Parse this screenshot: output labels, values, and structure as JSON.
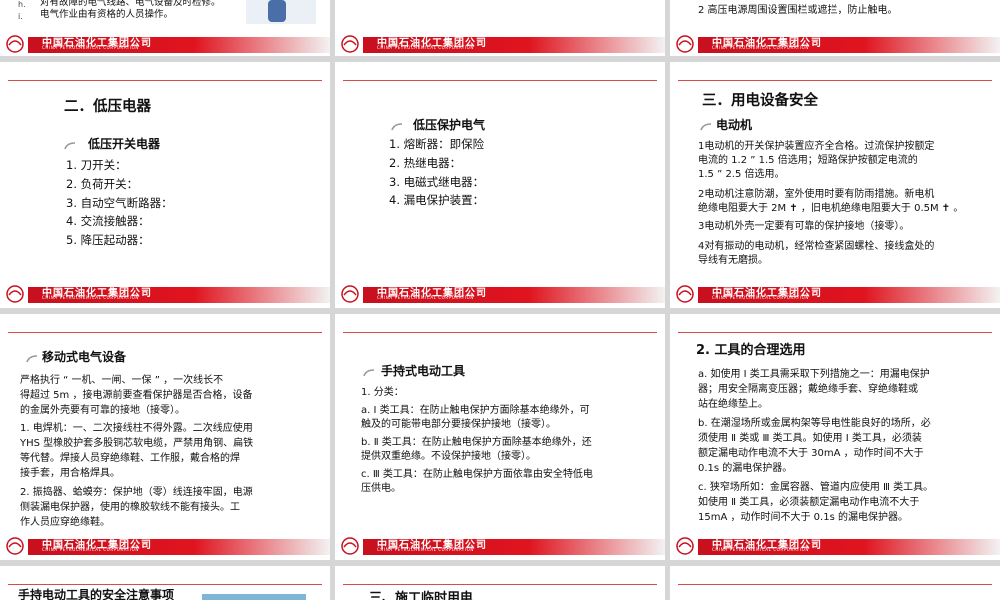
{
  "footer": {
    "company_cn": "中国石油化工集团公司",
    "company_en": "CHINA PETROCHEMICAL CORPORATION",
    "logo_text": "SINOPEC"
  },
  "s1": {
    "items": [
      {
        "marker": "h.",
        "text": "对有故障的电气线路、电气设备及时检修。"
      },
      {
        "marker": "i.",
        "text": "电气作业由有资格的人员操作。"
      }
    ]
  },
  "s3": {
    "item": "2   高压电源周围设置围栏或遮拦，防止触电。"
  },
  "s4": {
    "title": "二．低压电器",
    "subtitle": "低压开关电器",
    "items": [
      "1.   刀开关：",
      "2.   负荷开关：",
      "3.   自动空气断路器：",
      "4.   交流接触器：",
      "5.   降压起动器："
    ]
  },
  "s5": {
    "subtitle": "低压保护电气",
    "items": [
      "1.   熔断器：即保险",
      "2.   热继电器：",
      "3.   电磁式继电器：",
      "4.   漏电保护装置："
    ]
  },
  "s6": {
    "title": "三．用电设备安全",
    "subtitle": "电动机",
    "lines": [
      "1电动机的开关保护装置应齐全合格。过流保护按额定",
      "   电流的 1.2 ” 1.5 倍选用；短路保护按额定电流的",
      "   1.5 ” 2.5 倍选用。",
      "2电动机注意防潮，室外使用时要有防雨措施。新电机",
      "   绝缘电阻要大于 2M ✝ ，旧电机绝缘电阻要大于 0.5M ✝ 。",
      "3电动机外壳一定要有可靠的保护接地（接零）。",
      "4对有振动的电动机，经常检查紧固螺栓、接线盒处的",
      "   导线有无磨损。"
    ]
  },
  "s7": {
    "subtitle": "移动式电气设备",
    "lines": [
      "      严格执行 “ 一机、一闸、一保 ” ，一次线长不",
      "得超过 5m ，接电源前要查看保护器是否合格，设备",
      "的金属外壳要有可靠的接地（接零）。",
      "1.  电焊机：一、二次接线柱不得外露。二次线应使用",
      "     YHS 型橡胶护套多股铜芯软电缆，严禁用角钢、扁铁",
      "     等代替。焊接人员穿绝缘鞋、工作服，戴合格的焊",
      "     接手套，用合格焊具。",
      "2.  振捣器、蛤蟆夯：保护地（零）线连接牢固，电源",
      "     侧装漏电保护器，使用的橡胶软线不能有接头。工",
      "     作人员应穿绝缘鞋。"
    ]
  },
  "s8": {
    "subtitle": "手持式电动工具",
    "lines": [
      "1.   分类：",
      "a.    Ⅰ 类工具：在防止触电保护方面除基本绝缘外，可",
      "       触及的可能带电部分要接保护接地（接零）。",
      "b.    Ⅱ 类工具：在防止触电保护方面除基本绝缘外，还",
      "       提供双重绝缘。不设保护接地（接零）。",
      "c.    Ⅲ 类工具：在防止触电保护方面依靠由安全特低电",
      "       压供电。"
    ]
  },
  "s9": {
    "title": "2.   工具的合理选用",
    "lines": [
      "a.   如使用 Ⅰ 类工具需采取下列措施之一：用漏电保护",
      "      器；用安全隔离变压器；戴绝缘手套、穿绝缘鞋或",
      "      站在绝缘垫上。",
      "b.  在潮湿场所或金属构架等导电性能良好的场所，必",
      "      须使用 Ⅱ 类或 Ⅲ 类工具。如使用 Ⅰ 类工具，必须装",
      "      额定漏电动作电流不大于  30mA ，动作时间不大于",
      "      0.1s  的漏电保护器。",
      "c.  狭窄场所如：金属容器、管道内应使用 Ⅲ 类工具。",
      "      如使用 Ⅱ 类工具，必须装额定漏电动作电流不大于",
      "      15mA ，动作时间不大于  0.1s  的漏电保护器。"
    ]
  },
  "s10": {
    "title": "手持电动工具的安全注意事项"
  },
  "s11": {
    "title": "三、施工临时用电"
  },
  "colors": {
    "brand_red": "#d7141f",
    "rule_red": "#d94a4a",
    "bg": "#d6d6d6"
  }
}
